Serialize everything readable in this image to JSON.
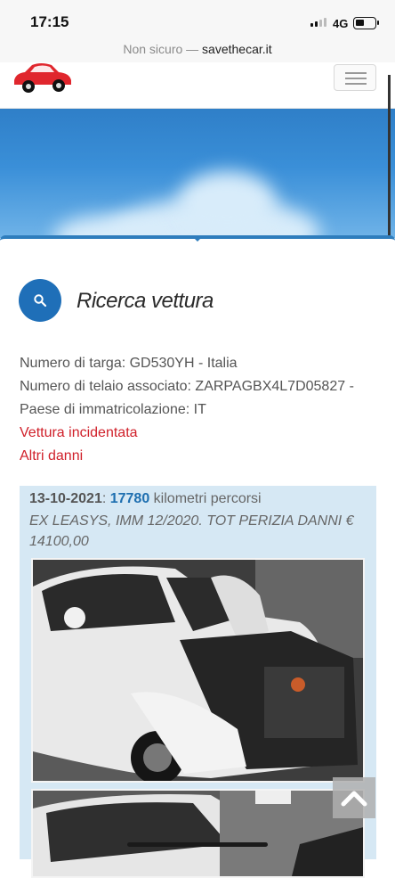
{
  "status": {
    "time": "17:15",
    "network": "4G",
    "battery_percent": 30
  },
  "browser": {
    "security": "Non sicuro",
    "separator": " — ",
    "host": "savethecar.it"
  },
  "site": {
    "logo_icon": "red-car-logo-icon",
    "menu_icon": "hamburger-icon"
  },
  "page": {
    "search_icon": "search-icon",
    "title": "Ricerca vettura"
  },
  "vehicle": {
    "plate": "Numero di targa: GD530YH - Italia",
    "vin": "Numero di telaio associato: ZARPAGBX4L7D05827 -",
    "country": "Paese di immatricolazione: IT",
    "status_1": "Vettura incidentata",
    "status_2": "Altri danni"
  },
  "entry": {
    "date": "13-10-2021",
    "date_sep": ": ",
    "km": "17780",
    "km_suffix": " kilometri percorsi",
    "description": "EX LEASYS, IMM 12/2020. TOT PERIZIA DANNI € 14100,00",
    "photo_icon": "damaged-car-photo",
    "photo2_icon": "car-photo"
  },
  "colors": {
    "accent": "#1f6fb8",
    "danger": "#d0202a",
    "entry_bg": "#d6e8f4"
  },
  "scroll_top_icon": "chevron-up-icon"
}
